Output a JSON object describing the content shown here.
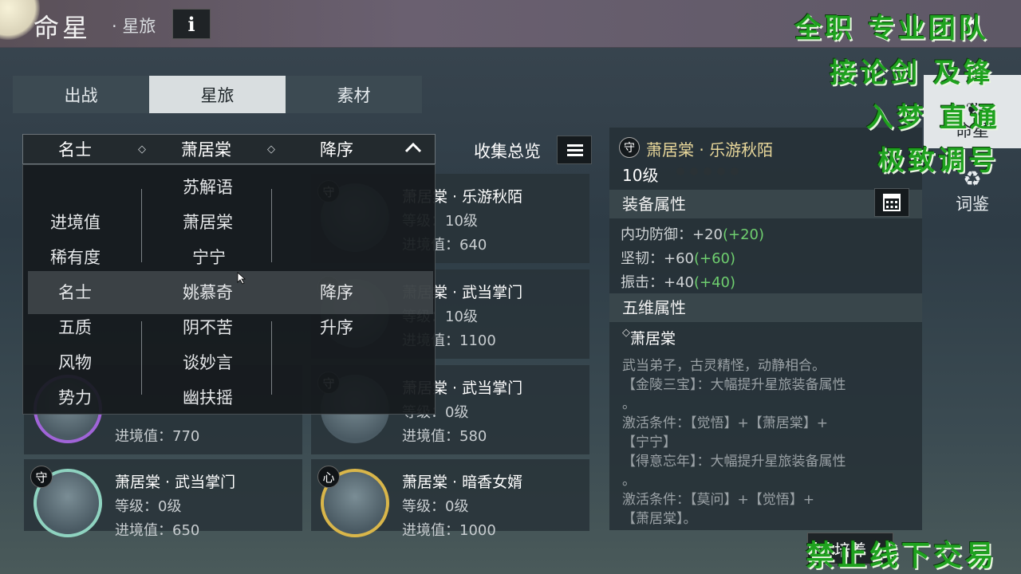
{
  "header": {
    "title": "命星",
    "subtitle": "· 星旅",
    "info_label": "i",
    "close_label": "✕"
  },
  "tabs": [
    {
      "label": "出战",
      "active": false
    },
    {
      "label": "星旅",
      "active": true
    },
    {
      "label": "素材",
      "active": false
    }
  ],
  "filter": {
    "category": "名士",
    "name": "萧居棠",
    "order": "降序"
  },
  "dropdown": {
    "col1": [
      "进境值",
      "稀有度",
      "名士",
      "五质",
      "风物",
      "势力"
    ],
    "col2": [
      "苏解语",
      "萧居棠",
      "宁宁",
      "姚慕奇",
      "阴不苦",
      "谈妙言",
      "幽扶摇"
    ],
    "col3": [
      "降序",
      "升序"
    ]
  },
  "collection": {
    "label": "收集总览"
  },
  "cards": [
    {
      "badge": "守",
      "name": "萧居棠 · 乐游秋陌",
      "level": "等级：10级",
      "progress": "进境值：640"
    },
    {
      "badge": "守",
      "name": "萧居棠 · 武当掌门",
      "level": "等级：10级",
      "progress": "进境值：1100"
    },
    {
      "badge": "守",
      "name": "萧居棠 · 武当掌门",
      "level": "等级：0级",
      "progress": "进境值：580"
    },
    {
      "badge": "",
      "name": "",
      "level": "",
      "progress": "进境值：770"
    },
    {
      "badge": "守",
      "name": "萧居棠 · 武当掌门",
      "level": "等级：0级",
      "progress": "进境值：650"
    },
    {
      "badge": "心",
      "name": "萧居棠 · 暗香女婿",
      "level": "等级：0级",
      "progress": "进境值：1000"
    }
  ],
  "detail": {
    "badge": "守",
    "title": "萧居棠 · 乐游秋陌",
    "level": "10级",
    "equip_header": "装备属性",
    "stats": [
      {
        "label": "内功防御：+20",
        "bonus": "(+20)"
      },
      {
        "label": "坚韧：+60",
        "bonus": "(+60)"
      },
      {
        "label": "振击：+40",
        "bonus": "(+40)"
      }
    ],
    "five_header": "五维属性",
    "char_name": "萧居棠",
    "lines": [
      "武当弟子，古灵精怪，动静相合。",
      "【金陵三宝】：大幅提升星旅装备属性",
      "。",
      "激活条件：【觉悟】+【萧居棠】+",
      "【宁宁】",
      "【得意忘年】：大幅提升星旅装备属性",
      "。",
      "激活条件：【莫问】+【觉悟】+",
      "【萧居棠】。"
    ]
  },
  "side": {
    "tab1": "命星",
    "tab2": "词鉴"
  },
  "cultivate_label": "培养",
  "watermarks": [
    "全职 专业团队",
    "接论剑 及锋",
    "入梦 直通",
    "极致调号",
    "禁止线下交易"
  ],
  "colors": {
    "accent_gold": "#e8d79a",
    "bonus_green": "#6fcf6f",
    "watermark_green": "#1fa21f"
  }
}
